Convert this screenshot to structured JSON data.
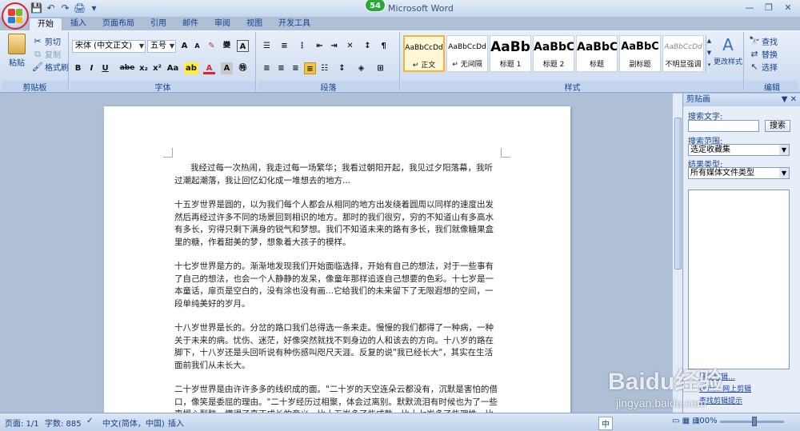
{
  "window": {
    "title": "Microsoft Word",
    "badge": "54"
  },
  "qat": {
    "save": "💾",
    "undo": "↶",
    "redo": "↷",
    "print": "🖨",
    "more": "▾"
  },
  "tabs": [
    "开始",
    "插入",
    "页面布局",
    "引用",
    "邮件",
    "审阅",
    "视图",
    "开发工具"
  ],
  "ribbon": {
    "clipboard": {
      "paste": "粘贴",
      "cut": "剪切",
      "copy": "复制",
      "format_painter": "格式刷",
      "label": "剪贴板"
    },
    "font": {
      "font_name": "宋体 (中文正文)",
      "font_size": "五号",
      "label": "字体",
      "bold": "B",
      "italic": "I",
      "underline": "U",
      "strike": "abe",
      "sub": "x₂",
      "sup": "x²",
      "aa": "Aa",
      "grow": "A",
      "shrink": "A",
      "wen": "變",
      "a_border": "A",
      "font_color": "A",
      "highlight": "ab",
      "char_shade": "A",
      "circle": "㊕"
    },
    "paragraph": {
      "label": "段落"
    },
    "styles": {
      "label": "样式",
      "items": [
        {
          "sample": "AaBbCcDd",
          "name": "↵ 正文",
          "selected": true
        },
        {
          "sample": "AaBbCcDd",
          "name": "↵ 无间隔",
          "selected": false
        },
        {
          "sample": "AaBb",
          "name": "标题 1",
          "selected": false
        },
        {
          "sample": "AaBbC",
          "name": "标题 2",
          "selected": false
        },
        {
          "sample": "AaBbC",
          "name": "标题",
          "selected": false
        },
        {
          "sample": "AaBbC",
          "name": "副标题",
          "selected": false
        },
        {
          "sample": "AaBbCcDd",
          "name": "不明显强调",
          "selected": false
        }
      ],
      "change": "更改样式"
    },
    "editing": {
      "find": "查找",
      "replace": "替换",
      "select": "选择",
      "label": "编辑"
    }
  },
  "document": {
    "paragraphs": [
      "我经过每一次热闹，我走过每一场繁华；我看过朝阳开起，我见过夕阳落幕，我听过潮起潮落，我让回忆幻化成一堆想去的地方...",
      "十五岁世界是圆的，以为我们每个人都会从相同的地方出发绕着圆周以同样的速度出发然后再经过许多不同的场景回到相识的地方。那时的我们很穷，穷的不知道山有多高水有多长，穷得只剩下满身的锐气和梦想。我们不知道未来的路有多长，我们就像糖果盒里的糖，作着甜美的梦，想象着大孩子的模样。",
      "十七岁世界是方的。渐渐地发现我们开始面临选择，开始有自己的想法，对于一些事有了自己的想法，也会一个人静静的发呆，像童年那样追逐自己想要的色彩。十七岁是一本童话，扉页是空白的，没有涂也没有画...它给我们的未来留下了无限遐想的空间，一段单纯美好的岁月。",
      "十八岁世界是长的。分岔的路口我们总得选一条来走。慢慢的我们都得了一种病，一种关于未来的病。忧伤、迷茫，好像突然就找不到身边的人和该去的方向。十八岁的路在脚下，十八岁还是头回听说有种伤感叫咫尺天涯。反复的说\"我已经长大\"，其实在生活面前我们从未长大。",
      "二十岁世界是由许许多多的线织成的面。\"二十岁的天空连朵云都没有，沉默是害怕的借口，像笑是委屈的理由。\"二十岁经历过相聚，体会过离别。默默流泪有时候也为了一些事搁心裂肺，懂得了真正成长的意义。比十五岁多了些成熟，比十七岁多了些理性，比十八岁多了"
    ]
  },
  "clipboard_pane": {
    "title": "剪贴画",
    "search_label": "搜索文字:",
    "search_value": "",
    "search_button": "搜索",
    "scope_label": "搜索范围:",
    "scope_value": "选定收藏集",
    "type_label": "结果类型:",
    "type_value": "所有媒体文件类型",
    "links": [
      "管理剪辑...",
      "Office 网上剪辑",
      "查找剪辑提示"
    ]
  },
  "statusbar": {
    "page": "页面: 1/1",
    "words": "字数: 885",
    "lang": "中文(简体，中国)",
    "mode": "插入",
    "zoom": "100%",
    "ime": "中"
  },
  "watermark": {
    "line1": "Baidu经验",
    "line2": "jingyan.baidu.com"
  }
}
